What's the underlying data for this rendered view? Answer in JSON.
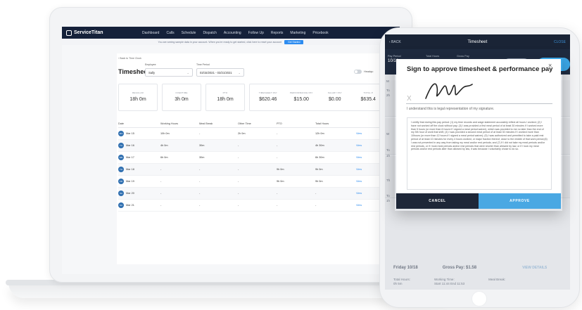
{
  "app": {
    "name": "ServiceTitan",
    "nav": [
      "Dashboard",
      "Calls",
      "Schedule",
      "Dispatch",
      "Accounting",
      "Follow Up",
      "Reports",
      "Marketing",
      "Pricebook"
    ]
  },
  "banner": {
    "text": "You are seeing sample data in your account. When you're ready to get started, click here to reset your account",
    "button": "Get Started"
  },
  "page": {
    "back": "‹ Back to Time Clock",
    "title": "Timesheet",
    "employee_label": "Employee",
    "employee_value": "Sally",
    "period_label": "Time Period",
    "period_value": "03/15/2021 - 03/21/2021",
    "toggle_label": "Headqu"
  },
  "cards": [
    {
      "label": "REGULAR",
      "value": "18h 0m"
    },
    {
      "label": "OVERTIME",
      "value": "3h 0m"
    },
    {
      "label": "PTO",
      "value": "18h 0m"
    }
  ],
  "pay": [
    {
      "label": "TIMESHEET PAY",
      "value": "$620.46"
    },
    {
      "label": "PERFORMANCE PAY",
      "value": "$15.00"
    },
    {
      "label": "SALARY PAY",
      "value": "$0.00"
    },
    {
      "label": "TOTAL P",
      "value": "$635.4"
    }
  ],
  "table": {
    "headers": [
      "Date",
      "Working Hours",
      "Meal Break",
      "Other Time",
      "PTO",
      "Total Hours"
    ],
    "rows": [
      {
        "badge": "MO",
        "date": "Mar 15",
        "work": "10h 0m",
        "meal": "-",
        "other": "2h 0m",
        "pto": "-",
        "total": "12h 0m",
        "action": "View"
      },
      {
        "badge": "TU",
        "date": "Mar 16",
        "work": "4h 0m",
        "meal": "30m",
        "other": "-",
        "pto": "-",
        "total": "4h 30m",
        "action": "View"
      },
      {
        "badge": "WE",
        "date": "Mar 17",
        "work": "6h 0m",
        "meal": "30m",
        "other": "-",
        "pto": "-",
        "total": "6h 30m",
        "action": "View"
      },
      {
        "badge": "TH",
        "date": "Mar 18",
        "work": "-",
        "meal": "-",
        "other": "-",
        "pto": "9h 0m",
        "total": "9h 0m",
        "action": "View"
      },
      {
        "badge": "FR",
        "date": "Mar 19",
        "work": "-",
        "meal": "-",
        "other": "-",
        "pto": "9h 0m",
        "total": "9h 0m",
        "action": "View"
      },
      {
        "badge": "SA",
        "date": "Mar 20",
        "work": "-",
        "meal": "-",
        "other": "-",
        "pto": "-",
        "total": "-",
        "action": "View"
      },
      {
        "badge": "SU",
        "date": "Mar 21",
        "work": "-",
        "meal": "-",
        "other": "-",
        "pto": "-",
        "total": "-",
        "action": "View"
      }
    ]
  },
  "phone": {
    "back": "‹ BACK",
    "title": "Timesheet",
    "close": "CLOSE",
    "pay_period_label": "Pay Period",
    "total_hours_label": "Total Hours",
    "gross_pay_label": "Gross Pay",
    "date_range": "10/14",
    "friday_day": "Friday 10/18",
    "friday_gross": "Gross Pay: $1.58",
    "view_details": "VIEW DETAILS",
    "total_hours": "Total Hours:",
    "total_hours_val": "0h 5m",
    "working_time": "Working Time:",
    "working_time_val": "Start 11:44 End 11:53",
    "meal_break": "Meal Break:",
    "cut_letters": [
      "M",
      "To",
      "2h",
      "W",
      "To",
      "1h",
      "Th",
      "To",
      "1h"
    ]
  },
  "modal": {
    "title": "Sign to approve timesheet & performance pay",
    "close": "×",
    "x_mark": "X",
    "legal": "I understand this is legal representation of my signature.",
    "agreement": "I certify that during this pay period: (1) my time records and wage statement accurately reflect all hours I worked; (2) I have not worked off the clock without pay; (3) I was provided a first meal period of at least 30 minutes if I worked more than 5 hours (or more than 6 hours if I signed a meal period waiver), which was provided to me no later than the end of my 5th hour of work that shift; (4) I was provided a second meal period of at least 30 minutes if I worked more than 10hours (or more than 12 hours if I signed a meal period waiver); (5) I was authorized and permitted to take a paid rest period of at least 10 minutes for every 4 hours worked, or major fraction thereof, close to the middle of that work period;(6) I was not prevented in any way from taking my meal and/or rest periods; and (7) If I did not take my meal periods and/or rest periods, or if I took meal periods and/or rest periods that were shorter than allowed by law, or if I took my meal periods and/or rest periods later than allowed by law, it was because I voluntarily chose to do so.",
    "cancel": "CANCEL",
    "approve": "APPROVE"
  }
}
